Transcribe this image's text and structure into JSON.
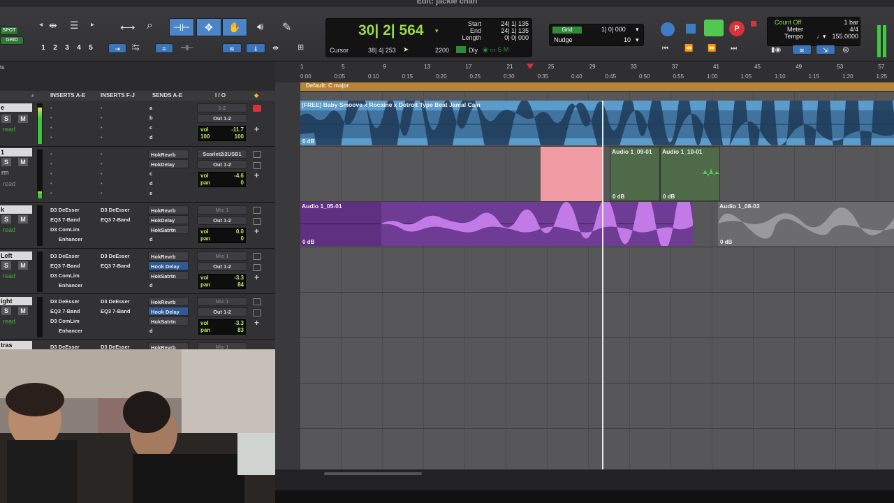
{
  "window": {
    "title": "Edit: jackie chan"
  },
  "toolbar": {
    "spot": "SPOT",
    "grid_mode": "GRID",
    "zoom_presets": [
      "1",
      "2",
      "3",
      "4",
      "5"
    ],
    "counter_main": "30| 2| 564",
    "start_label": "Start",
    "start_val": "24| 1| 135",
    "end_label": "End",
    "end_val": "24| 1| 135",
    "length_label": "Length",
    "length_val": "0| 0| 000",
    "cursor_label": "Cursor",
    "cursor_val": "38| 4| 253",
    "tempo_small": "2200",
    "dly_label": "Dly",
    "grid_label": "Grid",
    "grid_val": "1| 0| 000",
    "nudge_label": "Nudge",
    "nudge_val": "10",
    "count_off": "Count Off",
    "meter_label": "Meter",
    "tempo_label": "Tempo",
    "bar_val": "1 bar",
    "meter_val": "4/4",
    "tempo_val": "155.0000"
  },
  "ruler": {
    "bars": [
      "1",
      "5",
      "9",
      "13",
      "17",
      "21",
      "25",
      "29",
      "33",
      "37",
      "41",
      "45",
      "49",
      "53",
      "57"
    ],
    "times": [
      "0:00",
      "0:05",
      "0:10",
      "0:15",
      "0:20",
      "0:25",
      "0:30",
      "0:35",
      "0:40",
      "0:45",
      "0:50",
      "0:55",
      "1:00",
      "1:05",
      "1:10",
      "1:15",
      "1:20",
      "1:25"
    ],
    "marker": "Default: C major"
  },
  "left_header": {
    "title": "ts"
  },
  "mix_columns": {
    "inserts_ae": "INSERTS A-E",
    "inserts_fj": "INSERTS F-J",
    "sends_ae": "SENDS A-E",
    "io": "I / O"
  },
  "tracks": [
    {
      "name": "e",
      "ins1": [
        "",
        "",
        "",
        ""
      ],
      "ins2": [
        "",
        "",
        "",
        ""
      ],
      "sends": [
        "a",
        "b",
        "c",
        "d"
      ],
      "io_in": "1-2",
      "io_out": "Out 1-2",
      "vol": "-11.7",
      "pan_l": "100",
      "pan_r": "100",
      "read": "read"
    },
    {
      "name": "1",
      "ins1": [
        "",
        "",
        "",
        ""
      ],
      "ins2": [
        "",
        "",
        "",
        ""
      ],
      "sends": [
        "HokRevrb",
        "HokDelay",
        "c",
        "d",
        "e"
      ],
      "io_in": "Scarlet2i2USB1",
      "io_out": "Out 1-2",
      "vol": "-4.6",
      "pan_label": "pan",
      "pan": "0",
      "read": "read",
      "vol_label": "vol",
      "extra": "rm"
    },
    {
      "name": "k",
      "ins1": [
        "D3 DeEsser",
        "EQ3 7-Band",
        "D3 ComLim",
        "Enhancer"
      ],
      "ins2": [
        "D3 DeEsser",
        "EQ3 7-Band",
        "",
        ""
      ],
      "sends": [
        "HokRevrb",
        "HokDelay",
        "HokSatrtn",
        "d"
      ],
      "io_in": "Mic 1",
      "io_out": "Out 1-2",
      "vol": "0.0",
      "pan": "0",
      "read": "read"
    },
    {
      "name": "Left",
      "ins1": [
        "D3 DeEsser",
        "EQ3 7-Band",
        "D3 ComLim",
        "Enhancer"
      ],
      "ins2": [
        "D3 DeEsser",
        "EQ3 7-Band",
        "",
        ""
      ],
      "sends": [
        "HokRevrb",
        "Hook Delay",
        "HokSatrtn",
        "d"
      ],
      "io_in": "Mic 1",
      "io_out": "Out 1-2",
      "vol": "-3.3",
      "pan": "84",
      "read": "read"
    },
    {
      "name": "ight",
      "ins1": [
        "D3 DeEsser",
        "EQ3 7-Band",
        "D3 ComLim",
        "Enhancer"
      ],
      "ins2": [
        "D3 DeEsser",
        "EQ3 7-Band",
        "",
        ""
      ],
      "sends": [
        "HokRevrb",
        "Hook Delay",
        "HokSatrtn",
        "d"
      ],
      "io_in": "Mic 1",
      "io_out": "Out 1-2",
      "vol": "-3.3",
      "pan": "83",
      "read": "read"
    },
    {
      "name": "tras",
      "ins1": [
        "D3 DeEsser"
      ],
      "ins2": [
        "D3 DeEsser"
      ],
      "sends": [
        "HokRevrb"
      ],
      "io_in": "Mic 1"
    }
  ],
  "clips": {
    "beat_name": "[FREE] Baby Smoove x Rocaine x Detroit Type Beat Jamal Cain",
    "beat_db": "0 dB",
    "a1_09": "Audio 1_09-01",
    "a1_09_db": "0 dB",
    "a1_10": "Audio 1_10-01",
    "a1_10_db": "0 dB",
    "a1_05": "Audio 1_05-01",
    "a1_05_db": "0 dB",
    "a1_08": "Audio 1_08-03",
    "a1_08_db": "0 dB"
  },
  "colors": {
    "accent_blue": "#4c84c9",
    "record_red": "#d8323a",
    "play_green": "#46c84a",
    "beat_clip": "#5a9ccc",
    "vocal_clip": "#7b3ea8"
  }
}
